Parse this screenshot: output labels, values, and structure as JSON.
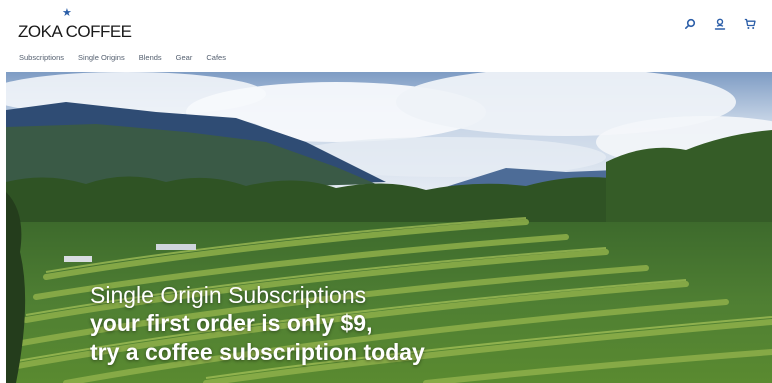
{
  "header": {
    "brand": "ZOKA COFFEE",
    "icons": {
      "search": "search-icon",
      "account": "user-icon",
      "cart": "cart-icon"
    },
    "accent_color": "#2b5ea8"
  },
  "nav": {
    "items": [
      {
        "label": "Subscriptions"
      },
      {
        "label": "Single Origins"
      },
      {
        "label": "Blends"
      },
      {
        "label": "Gear"
      },
      {
        "label": "Cafes"
      }
    ]
  },
  "hero": {
    "headline": "Single Origin Subscriptions",
    "line2": "your first order is only $9,",
    "line3": "try a coffee subscription today"
  }
}
